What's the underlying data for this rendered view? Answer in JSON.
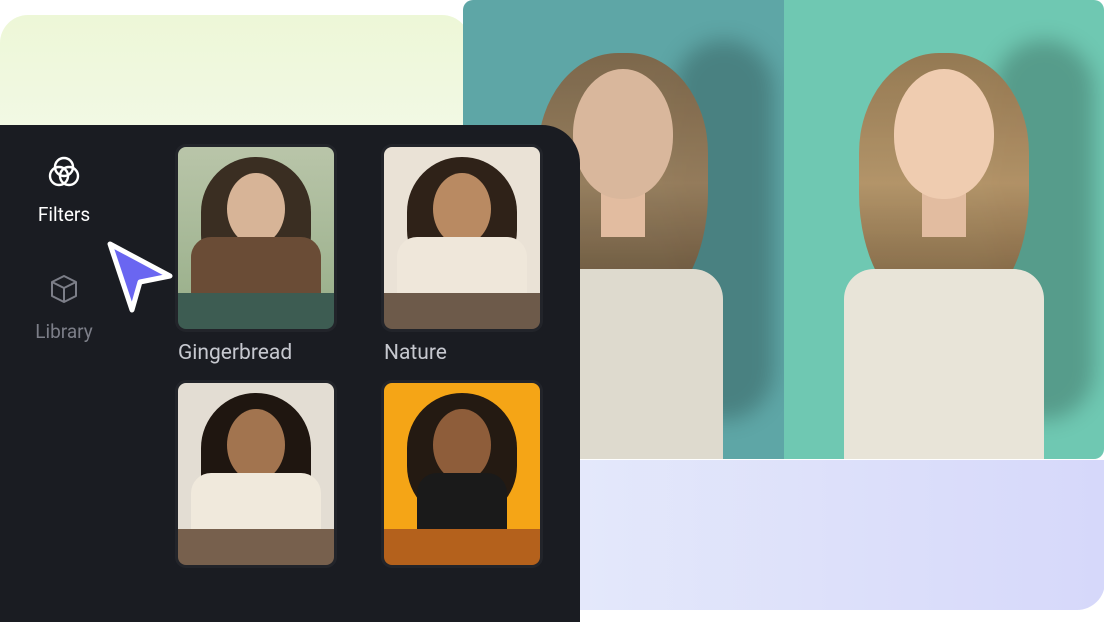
{
  "sidebar": {
    "items": [
      {
        "label": "Filters",
        "icon": "filters-icon",
        "active": true
      },
      {
        "label": "Library",
        "icon": "library-icon",
        "active": false
      }
    ]
  },
  "filters": [
    {
      "label": "Gingerbread",
      "swatch": "#3d5c52"
    },
    {
      "label": "Nature",
      "swatch": "#6d5a4a"
    },
    {
      "label": "",
      "swatch": "#77604d"
    },
    {
      "label": "",
      "swatch": "#b4611c"
    }
  ],
  "colors": {
    "cursor": "#6a66f1",
    "panel_bg": "#1a1c22"
  }
}
